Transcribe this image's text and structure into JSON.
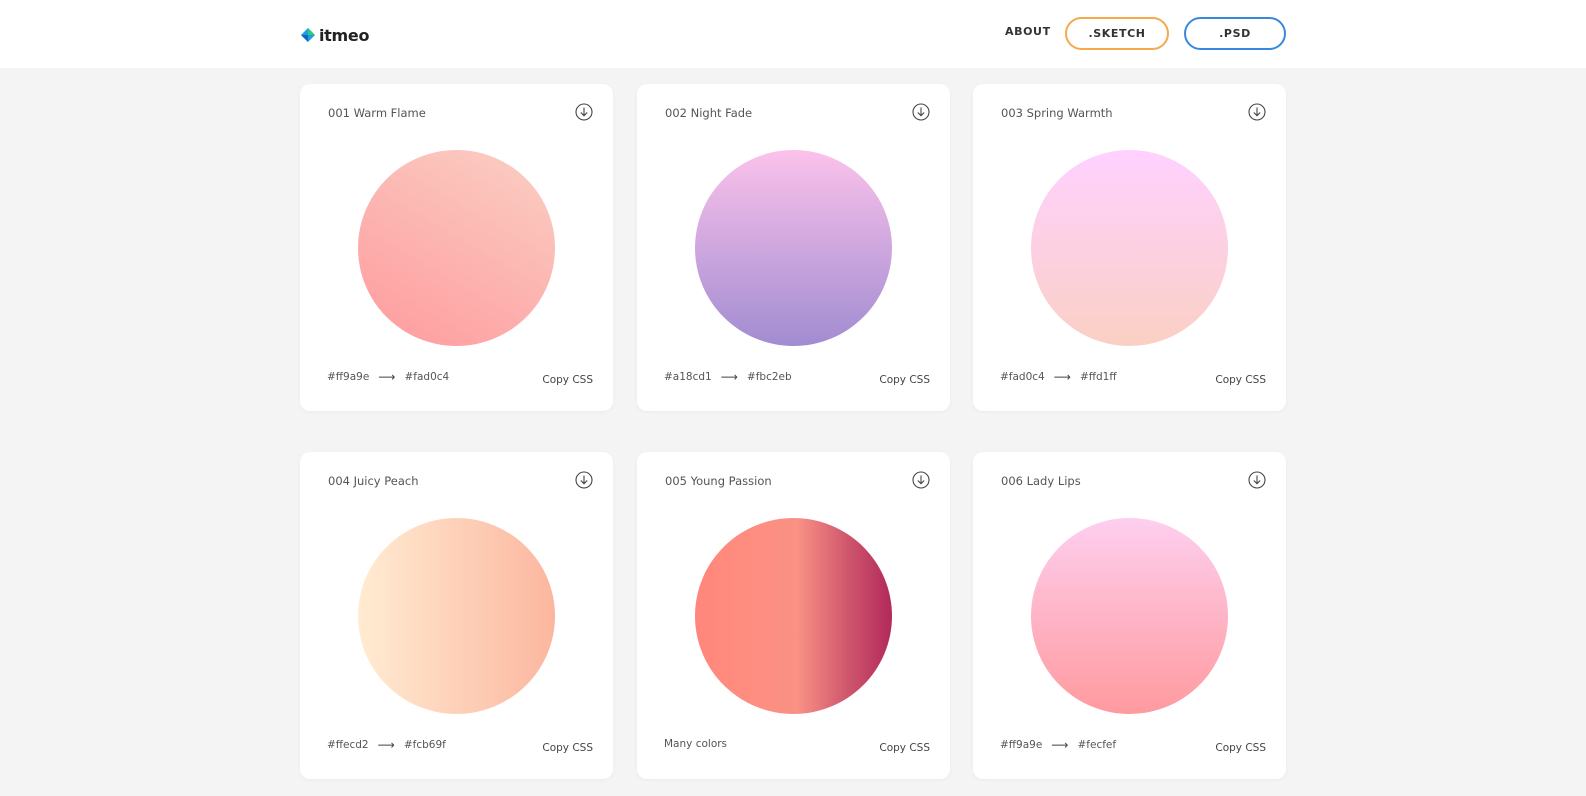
{
  "header": {
    "logo_text": "itmeo",
    "nav": {
      "about": "ABOUT",
      "sketch": ".SKETCH",
      "psd": ".PSD"
    },
    "colors": {
      "sketch_border": "#f5a94a",
      "psd_border": "#3a87e0"
    }
  },
  "cards": [
    {
      "title": "001 Warm Flame",
      "from": "#ff9a9e",
      "arrow": "⟶",
      "to": "#fad0c4",
      "copy": "Copy CSS"
    },
    {
      "title": "002 Night Fade",
      "from": "#a18cd1",
      "arrow": "⟶",
      "to": "#fbc2eb",
      "copy": "Copy CSS"
    },
    {
      "title": "003 Spring Warmth",
      "from": "#fad0c4",
      "arrow": "⟶",
      "to": "#ffd1ff",
      "copy": "Copy CSS"
    },
    {
      "title": "004 Juicy Peach",
      "from": "#ffecd2",
      "arrow": "⟶",
      "to": "#fcb69f",
      "copy": "Copy CSS"
    },
    {
      "title": "005 Young Passion",
      "label": "Many colors",
      "copy": "Copy CSS"
    },
    {
      "title": "006 Lady Lips",
      "from": "#ff9a9e",
      "arrow": "⟶",
      "to": "#fecfef",
      "copy": "Copy CSS"
    }
  ],
  "icons": {
    "download": "download-circle-icon",
    "logo": "diamond-logo-icon"
  }
}
